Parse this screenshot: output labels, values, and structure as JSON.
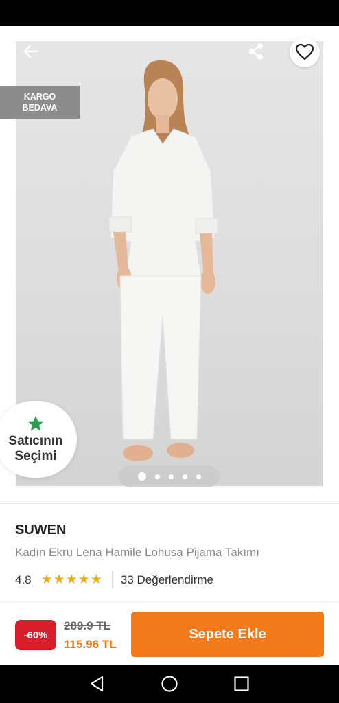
{
  "header": {
    "back_icon": "arrow-left-icon",
    "share_icon": "share-icon",
    "favorite_icon": "heart-outline-icon"
  },
  "photo": {
    "cargo_badge_line1": "KARGO",
    "cargo_badge_line2": "BEDAVA",
    "seller_choice_line1": "Satıcının",
    "seller_choice_line2": "Seçimi",
    "seller_choice_icon": "star-icon",
    "carousel_total": 5,
    "carousel_active": 1
  },
  "product": {
    "brand": "SUWEN",
    "name": "Kadın Ekru Lena Hamile Lohusa Pijama Takımı",
    "rating": "4.8",
    "stars": 5,
    "review_count": "33 Değerlendirme"
  },
  "purchase": {
    "discount": "-60%",
    "old_price": "289.9 TL",
    "new_price": "115.96 TL",
    "add_to_cart": "Sepete Ekle"
  },
  "colors": {
    "accent": "#f27a1a",
    "discount": "#d81e2b",
    "star": "#f5a70b",
    "choice_star": "#2e9e4a"
  },
  "nav": {
    "back_icon": "triangle-back-icon",
    "home_icon": "circle-home-icon",
    "recents_icon": "square-recents-icon"
  }
}
